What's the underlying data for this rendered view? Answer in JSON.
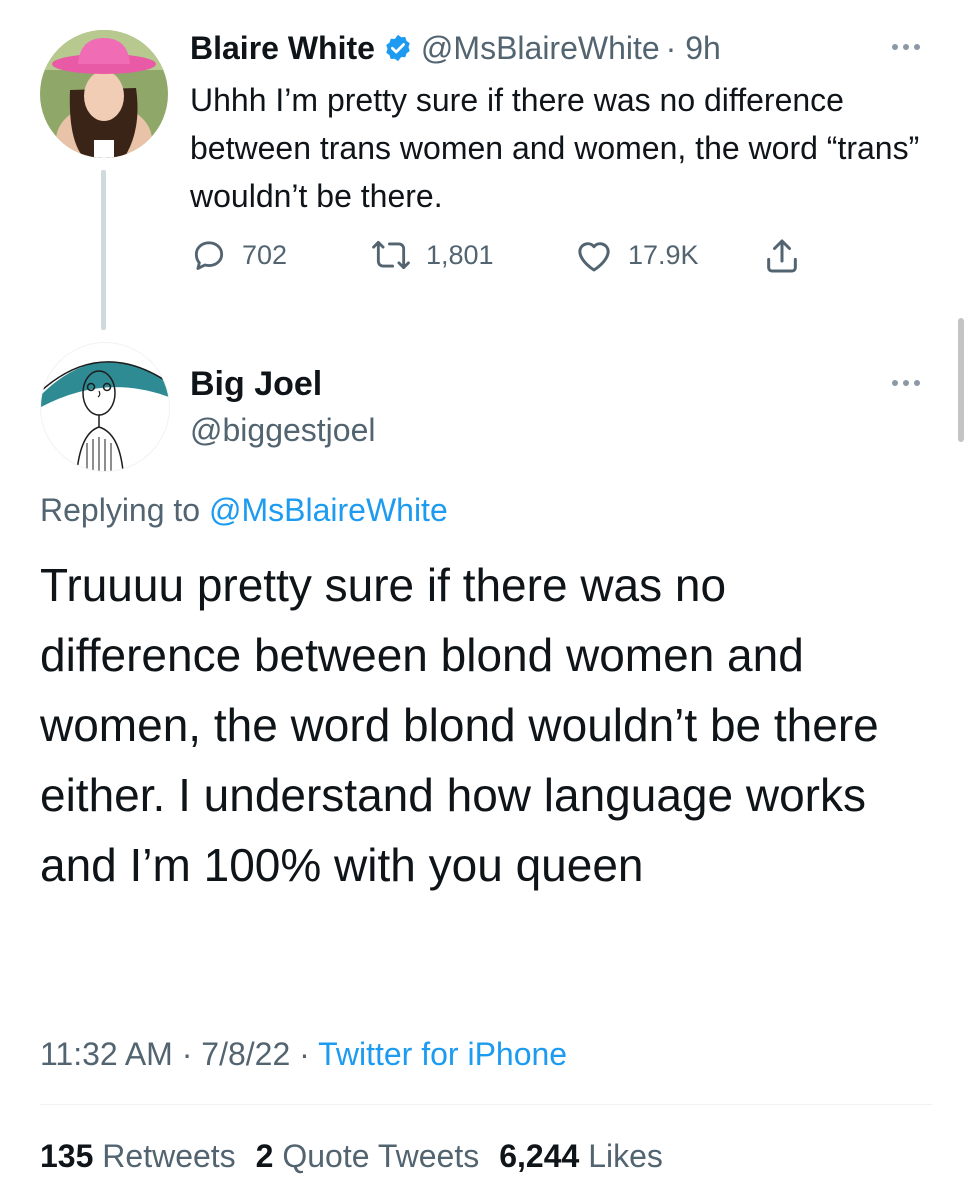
{
  "parent_tweet": {
    "display_name": "Blaire White",
    "handle": "@MsBlaireWhite",
    "time": "· 9h",
    "text": "Uhhh I’m pretty sure if there was no difference between trans women and women, the word “trans” wouldn’t be there.",
    "actions": {
      "replies": "702",
      "retweets": "1,801",
      "likes": "17.9K"
    },
    "verified": true
  },
  "reply_tweet": {
    "display_name": "Big Joel",
    "handle": "@biggestjoel",
    "replying_prefix": "Replying to",
    "replying_to": "@MsBlaireWhite",
    "text": "Truuuu pretty sure if there was no difference between blond women and women, the word blond wouldn’t be there either. I understand how language works and I’m 100% with you queen",
    "timestamp": "11:32 AM · 7/8/22 · ",
    "source": "Twitter for iPhone",
    "stats": {
      "retweets_count": "135",
      "retweets_label": "Retweets",
      "quotes_count": "2",
      "quotes_label": "Quote Tweets",
      "likes_count": "6,244",
      "likes_label": "Likes"
    }
  },
  "colors": {
    "accent": "#1d9bf0",
    "text": "#0f1419",
    "muted": "#536471",
    "thread_line": "#cfd9de"
  },
  "icons": [
    "verified-badge-icon",
    "reply-icon",
    "retweet-icon",
    "like-icon",
    "share-icon",
    "more-icon"
  ]
}
